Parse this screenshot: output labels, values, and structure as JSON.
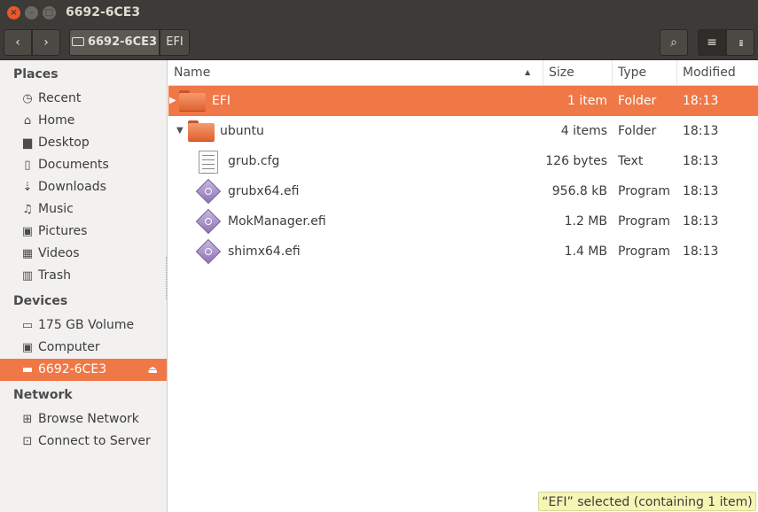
{
  "window": {
    "title": "6692-6CE3",
    "close_label": "×",
    "min_label": "–",
    "max_label": "□"
  },
  "toolbar": {
    "back_label": "‹",
    "forward_label": "›",
    "breadcrumb": [
      {
        "label": "6692-6CE3"
      },
      {
        "label": "EFI"
      }
    ],
    "search_label": "⌕",
    "list_view_label": "≡",
    "grid_view_label": "⁞⁞⁞"
  },
  "sidebar": {
    "places_header": "Places",
    "places": [
      {
        "label": "Recent",
        "icon": "clock-icon",
        "glyph": "◷"
      },
      {
        "label": "Home",
        "icon": "home-icon",
        "glyph": "⌂"
      },
      {
        "label": "Desktop",
        "icon": "folder-icon",
        "glyph": "▆"
      },
      {
        "label": "Documents",
        "icon": "document-icon",
        "glyph": "▯"
      },
      {
        "label": "Downloads",
        "icon": "download-icon",
        "glyph": "⇣"
      },
      {
        "label": "Music",
        "icon": "music-icon",
        "glyph": "♫"
      },
      {
        "label": "Pictures",
        "icon": "camera-icon",
        "glyph": "▣"
      },
      {
        "label": "Videos",
        "icon": "film-icon",
        "glyph": "▦"
      },
      {
        "label": "Trash",
        "icon": "trash-icon",
        "glyph": "▥"
      }
    ],
    "devices_header": "Devices",
    "devices": [
      {
        "label": "175 GB Volume",
        "icon": "drive-icon",
        "glyph": "▭"
      },
      {
        "label": "Computer",
        "icon": "computer-icon",
        "glyph": "▣"
      },
      {
        "label": "6692-6CE3",
        "icon": "usb-drive-icon",
        "glyph": "▬",
        "eject": "⏏"
      }
    ],
    "network_header": "Network",
    "network": [
      {
        "label": "Browse Network",
        "icon": "network-icon",
        "glyph": "⊞"
      },
      {
        "label": "Connect to Server",
        "icon": "server-icon",
        "glyph": "⊡"
      }
    ]
  },
  "columns": {
    "name": "Name",
    "sort_indicator": "▲",
    "size": "Size",
    "type": "Type",
    "modified": "Modified"
  },
  "files": [
    {
      "name": "EFI",
      "size": "1 item",
      "type": "Folder",
      "modified": "18:13",
      "icon": "folder-icon",
      "expander": "▶"
    },
    {
      "name": "ubuntu",
      "size": "4 items",
      "type": "Folder",
      "modified": "18:13",
      "icon": "folder-icon",
      "expander": "▼"
    },
    {
      "name": "grub.cfg",
      "size": "126 bytes",
      "type": "Text",
      "modified": "18:13",
      "icon": "text-file-icon"
    },
    {
      "name": "grubx64.efi",
      "size": "956.8 kB",
      "type": "Program",
      "modified": "18:13",
      "icon": "executable-icon"
    },
    {
      "name": "MokManager.efi",
      "size": "1.2 MB",
      "type": "Program",
      "modified": "18:13",
      "icon": "executable-icon"
    },
    {
      "name": "shimx64.efi",
      "size": "1.4 MB",
      "type": "Program",
      "modified": "18:13",
      "icon": "executable-icon"
    }
  ],
  "status": "“EFI” selected  (containing 1 item)",
  "colors": {
    "accent": "#f07746",
    "titlebar": "#3c3b37",
    "sidebar": "#f2f1f0",
    "status_bg": "#f5f5b5"
  }
}
